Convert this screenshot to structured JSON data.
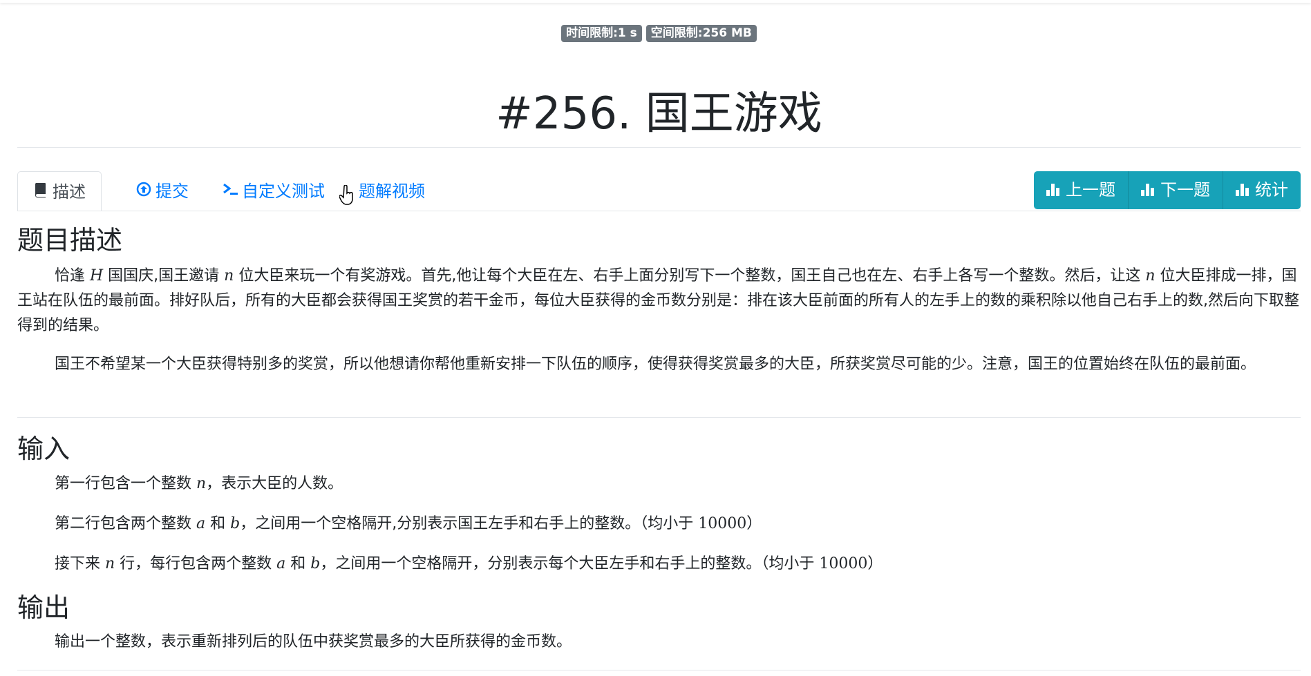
{
  "badges": {
    "time_limit": "时间限制:1 s",
    "memory_limit": "空间限制:256 MB"
  },
  "title": "#256. 国王游戏",
  "tabs": [
    {
      "label": "描述",
      "icon": "book-icon",
      "active": true
    },
    {
      "label": "提交",
      "icon": "upload-circle-icon",
      "active": false
    },
    {
      "label": "自定义测试",
      "icon": "terminal-icon",
      "active": false
    },
    {
      "label": "题解视频",
      "icon": "video-icon",
      "active": false
    }
  ],
  "buttons": {
    "prev": "上一题",
    "next": "下一题",
    "stats": "统计"
  },
  "sections": {
    "desc_heading": "题目描述",
    "input_heading": "输入",
    "output_heading": "输出"
  },
  "desc": {
    "p1_a": "恰逢 ",
    "p1_var_h": "H",
    "p1_b": " 国国庆,国王邀请 ",
    "p1_var_n": "n",
    "p1_c": " 位大臣来玩一个有奖游戏。首先,他让每个大臣在左、右手上面分别写下一个整数，国王自己也在左、右手上各写一个整数。然后，让这 ",
    "p1_var_n2": "n",
    "p1_d": " 位大臣排成一排，国王站在队伍的最前面。排好队后，所有的大臣都会获得国王奖赏的若干金币，每位大臣获得的金币数分别是：排在该大臣前面的所有人的左手上的数的乘积除以他自己右手上的数,然后向下取整得到的结果。",
    "p2": "国王不希望某一个大臣获得特别多的奖赏，所以他想请你帮他重新安排一下队伍的顺序，使得获得奖赏最多的大臣，所获奖赏尽可能的少。注意，国王的位置始终在队伍的最前面。"
  },
  "input": {
    "l1_a": "第一行包含一个整数 ",
    "l1_var": "n",
    "l1_b": "，表示大臣的人数。",
    "l2_a": "第二行包含两个整数 ",
    "l2_var_a": "a",
    "l2_b": " 和 ",
    "l2_var_b": "b",
    "l2_c": "，之间用一个空格隔开,分别表示国王左手和右手上的整数。（均小于 ",
    "l2_num": "10000",
    "l2_d": "）",
    "l3_a": "接下来 ",
    "l3_var_n": "n",
    "l3_b": " 行，每行包含两个整数 ",
    "l3_var_a": "a",
    "l3_c": " 和 ",
    "l3_var_b": "b",
    "l3_d": "，之间用一个空格隔开，分别表示每个大臣左手和右手上的整数。（均小于 ",
    "l3_num": "10000",
    "l3_e": "）"
  },
  "output": {
    "l1": "输出一个整数，表示重新排列后的队伍中获奖赏最多的大臣所获得的金币数。"
  },
  "colors": {
    "link": "#007bff",
    "button": "#17a2b8",
    "badge": "#6c757d"
  }
}
